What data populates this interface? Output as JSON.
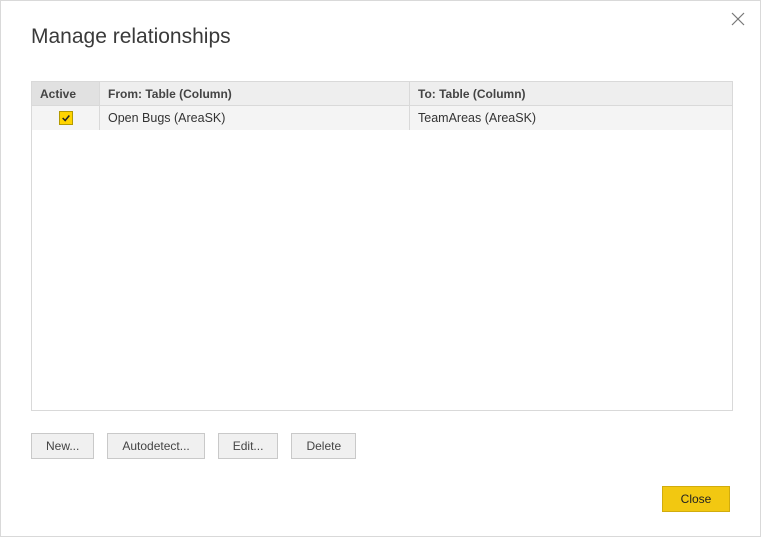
{
  "dialog": {
    "title": "Manage relationships"
  },
  "table": {
    "headers": {
      "active": "Active",
      "from": "From: Table (Column)",
      "to": "To: Table (Column)"
    },
    "rows": [
      {
        "active": true,
        "from": "Open Bugs (AreaSK)",
        "to": "TeamAreas (AreaSK)"
      }
    ]
  },
  "buttons": {
    "new": "New...",
    "autodetect": "Autodetect...",
    "edit": "Edit...",
    "delete": "Delete",
    "close": "Close"
  }
}
